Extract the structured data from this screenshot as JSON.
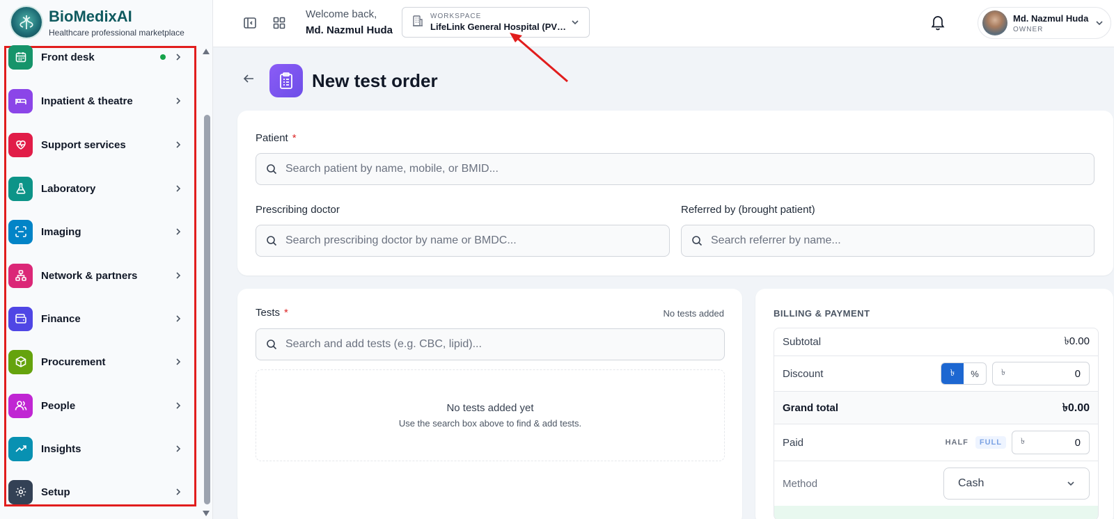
{
  "brand": {
    "name": "BioMedixAI",
    "tagline": "Healthcare professional marketplace"
  },
  "sidebar": {
    "items": [
      {
        "label": "Front desk",
        "icon": "calendar-icon",
        "color": "#16946a",
        "dot": true
      },
      {
        "label": "Inpatient & theatre",
        "icon": "bed-icon",
        "color": "#8b45e8"
      },
      {
        "label": "Support services",
        "icon": "heart-pulse-icon",
        "color": "#e11d48"
      },
      {
        "label": "Laboratory",
        "icon": "flask-icon",
        "color": "#0d9488"
      },
      {
        "label": "Imaging",
        "icon": "scan-icon",
        "color": "#0284c7"
      },
      {
        "label": "Network & partners",
        "icon": "network-icon",
        "color": "#db2777"
      },
      {
        "label": "Finance",
        "icon": "wallet-icon",
        "color": "#4f46e5"
      },
      {
        "label": "Procurement",
        "icon": "box-icon",
        "color": "#65a30d"
      },
      {
        "label": "People",
        "icon": "users-icon",
        "color": "#c026d3"
      },
      {
        "label": "Insights",
        "icon": "trending-up-icon",
        "color": "#0891b2"
      },
      {
        "label": "Setup",
        "icon": "gear-icon",
        "color": "#334155"
      }
    ]
  },
  "topbar": {
    "welcome": "Welcome back,",
    "user_name": "Md. Nazmul Huda",
    "workspace_label": "WORKSPACE",
    "workspace_value": "LifeLink General Hospital (PVT) Ltd.",
    "user_display": "Md. Nazmul Huda",
    "user_role": "OWNER"
  },
  "page": {
    "title": "New test order"
  },
  "form": {
    "patient_label": "Patient",
    "required_mark": "*",
    "patient_placeholder": "Search patient by name, mobile, or BMID...",
    "doctor_label": "Prescribing doctor",
    "doctor_placeholder": "Search prescribing doctor by name or BMDC...",
    "referrer_label": "Referred by (brought patient)",
    "referrer_placeholder": "Search referrer by name..."
  },
  "tests": {
    "label": "Tests",
    "count_text": "No tests added",
    "placeholder": "Search and add tests (e.g. CBC, lipid)...",
    "empty_title": "No tests added yet",
    "empty_hint": "Use the search box above to find & add tests."
  },
  "billing": {
    "heading": "BILLING & PAYMENT",
    "subtotal_label": "Subtotal",
    "subtotal_value": "৳0.00",
    "discount_label": "Discount",
    "discount_mode_currency": "৳",
    "discount_mode_percent": "%",
    "discount_currency": "৳",
    "discount_value": "0",
    "grand_total_label": "Grand total",
    "grand_total_value": "৳0.00",
    "paid_label": "Paid",
    "half_label": "HALF",
    "full_label": "FULL",
    "paid_currency": "৳",
    "paid_value": "0",
    "method_label": "Method",
    "method_value": "Cash"
  }
}
